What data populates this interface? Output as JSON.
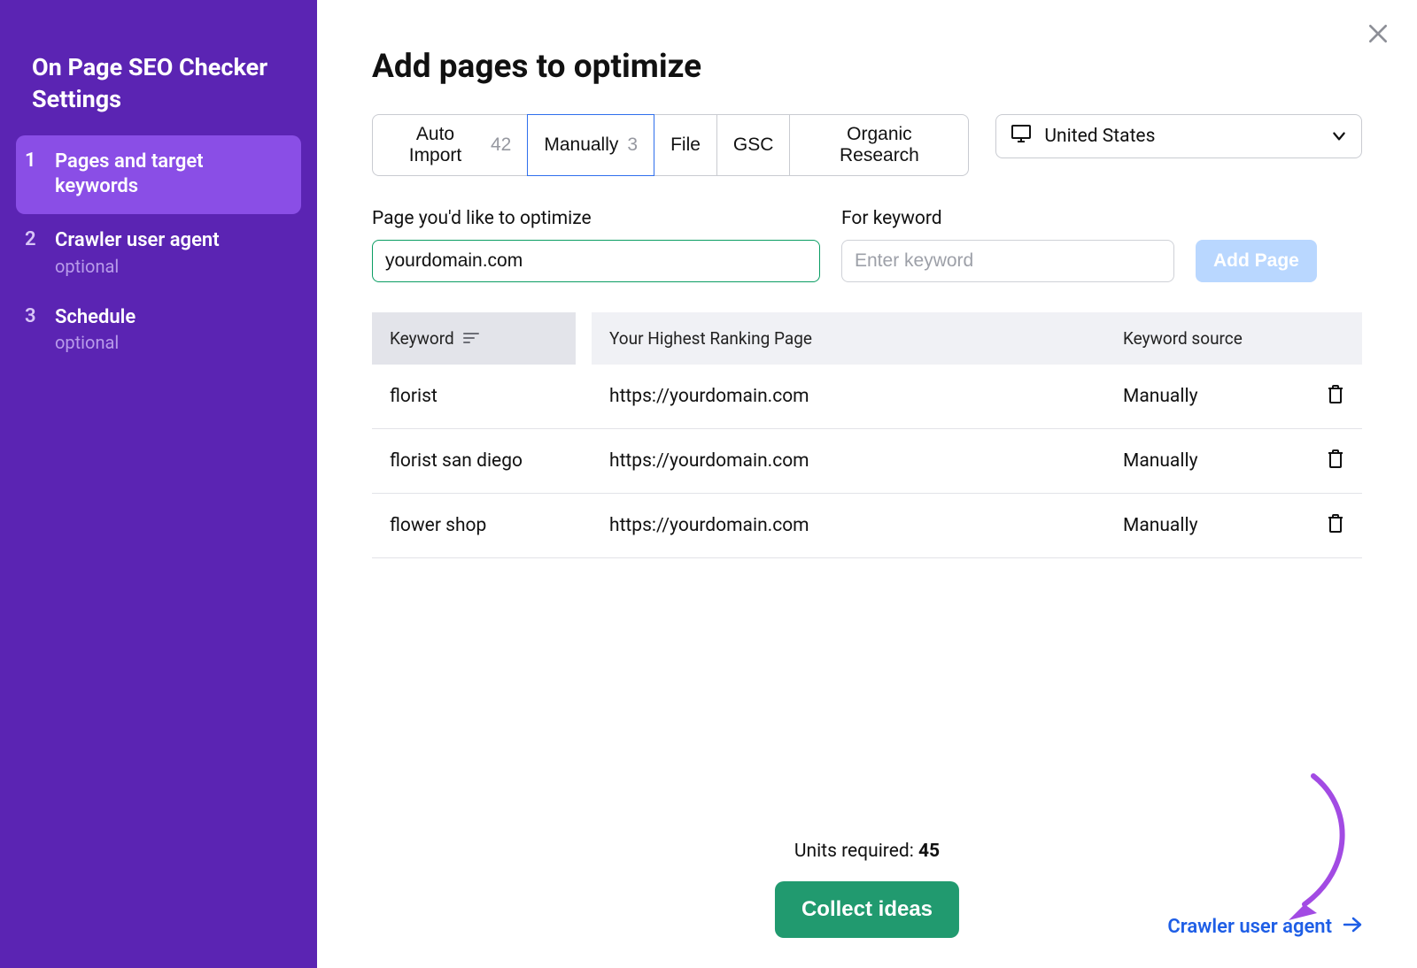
{
  "sidebar": {
    "title": "On Page SEO Checker Settings",
    "steps": [
      {
        "num": "1",
        "label": "Pages and target keywords",
        "sub": "",
        "active": true
      },
      {
        "num": "2",
        "label": "Crawler user agent",
        "sub": "optional",
        "active": false
      },
      {
        "num": "3",
        "label": "Schedule",
        "sub": "optional",
        "active": false
      }
    ]
  },
  "header": {
    "title": "Add pages to optimize"
  },
  "tabs": [
    {
      "label": "Auto Import",
      "badge": "42",
      "active": false
    },
    {
      "label": "Manually",
      "badge": "3",
      "active": true
    },
    {
      "label": "File",
      "badge": "",
      "active": false
    },
    {
      "label": "GSC",
      "badge": "",
      "active": false
    },
    {
      "label": "Organic Research",
      "badge": "",
      "active": false
    }
  ],
  "country": {
    "label": "United States"
  },
  "form": {
    "page_label": "Page you'd like to optimize",
    "page_value": "yourdomain.com",
    "kw_label": "For keyword",
    "kw_placeholder": "Enter keyword",
    "add_label": "Add Page"
  },
  "table": {
    "headers": {
      "keyword": "Keyword",
      "page": "Your Highest Ranking Page",
      "source": "Keyword source"
    },
    "rows": [
      {
        "keyword": "florist",
        "page": "https://yourdomain.com",
        "source": "Manually"
      },
      {
        "keyword": "florist san diego",
        "page": "https://yourdomain.com",
        "source": "Manually"
      },
      {
        "keyword": "flower shop",
        "page": "https://yourdomain.com",
        "source": "Manually"
      }
    ]
  },
  "footer": {
    "units_label": "Units required: ",
    "units_value": "45",
    "collect_label": "Collect ideas",
    "next_label": "Crawler user agent"
  }
}
